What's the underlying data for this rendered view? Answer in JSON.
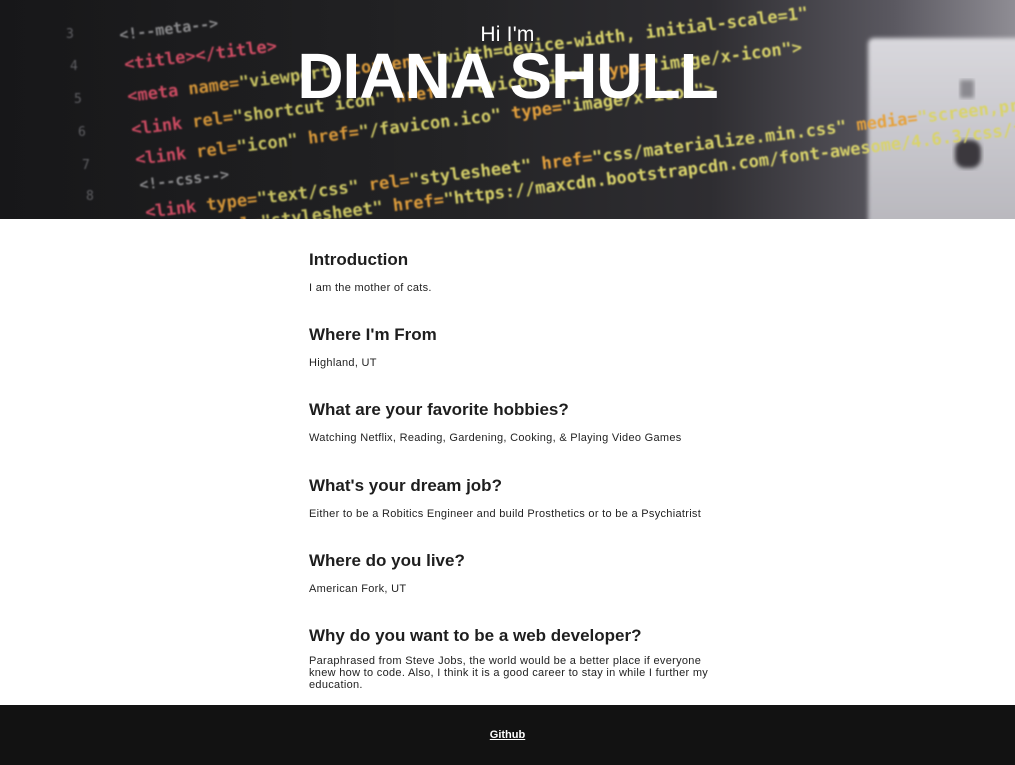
{
  "hero": {
    "greeting": "Hi I'm",
    "name": "DIANA SHULL"
  },
  "sections": [
    {
      "question": "Introduction",
      "answer": "I am the mother of cats."
    },
    {
      "question": "Where I'm From",
      "answer": "Highland, UT"
    },
    {
      "question": "What are your favorite hobbies?",
      "answer": "Watching Netflix, Reading, Gardening, Cooking, & Playing Video Games"
    },
    {
      "question": "What's your dream job?",
      "answer": "Either to be a Robitics Engineer and build Prosthetics or to be a Psychiatrist"
    },
    {
      "question": "Where do you live?",
      "answer": "American Fork, UT"
    },
    {
      "question": "Why do you want to be a web developer?",
      "answer": "Paraphrased from Steve Jobs, the world would be a better place if everyone knew how to code. Also, I think it is a good career to stay in while I further my education."
    }
  ],
  "footer": {
    "link_label": "Github"
  },
  "colors": {
    "footer_bg": "#121212",
    "hero_text": "#ffffff"
  }
}
